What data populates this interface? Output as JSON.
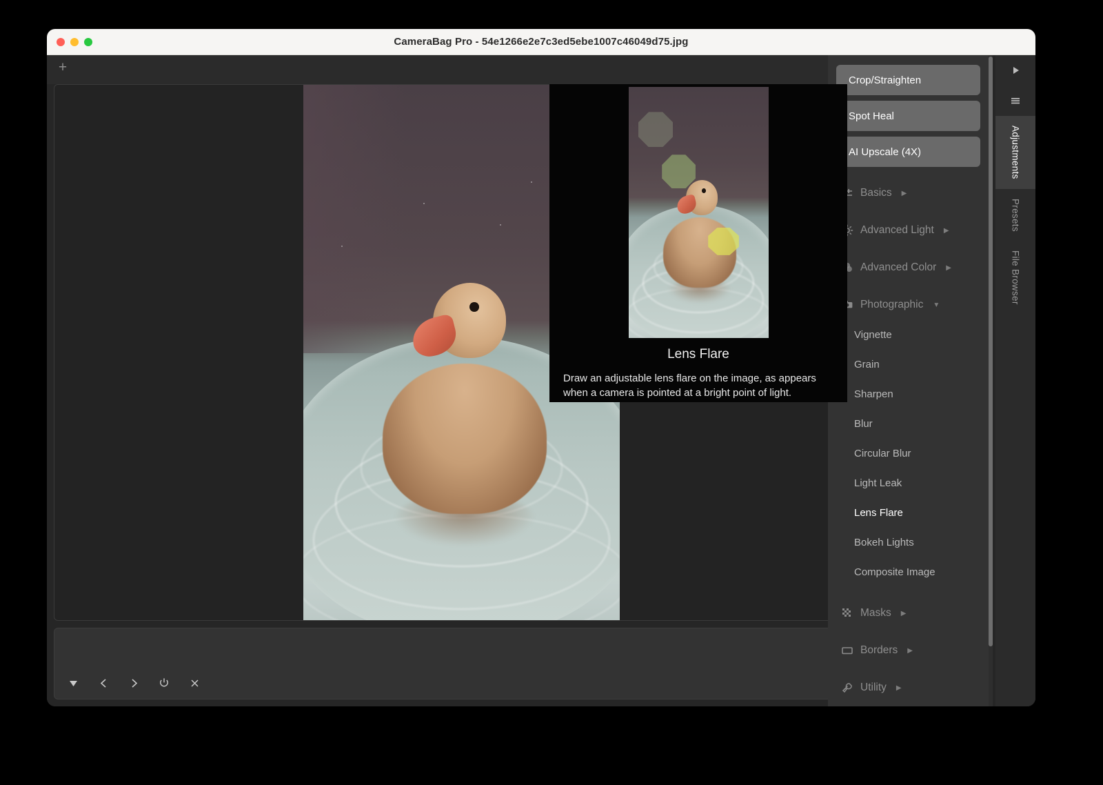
{
  "window": {
    "title": "CameraBag Pro - 54e1266e2e7c3ed5ebe1007c46049d75.jpg",
    "traffic_lights": {
      "close": "close-window",
      "minimize": "minimize-window",
      "zoom": "zoom-window"
    }
  },
  "toolbar": {
    "add_label": "+"
  },
  "info_popup": {
    "title": "Lens Flare",
    "description": "Draw an adjustable lens flare on the image, as appears when a camera is pointed at a bright point of light."
  },
  "sidebar": {
    "tool_buttons": [
      {
        "label": "Crop/Straighten",
        "name": "crop-straighten-button"
      },
      {
        "label": "Spot Heal",
        "name": "spot-heal-button"
      },
      {
        "label": "AI Upscale (4X)",
        "name": "ai-upscale-button"
      }
    ],
    "groups": [
      {
        "label": "Basics",
        "icon": "sliders-icon",
        "caret": "▶",
        "expanded": false
      },
      {
        "label": "Advanced Light",
        "icon": "sun-icon",
        "caret": "▶",
        "expanded": false
      },
      {
        "label": "Advanced Color",
        "icon": "color-circles-icon",
        "caret": "▶",
        "expanded": false
      },
      {
        "label": "Photographic",
        "icon": "camera-icon",
        "caret": "▼",
        "expanded": true
      },
      {
        "label": "Masks",
        "icon": "checker-mask-icon",
        "caret": "▶",
        "expanded": false
      },
      {
        "label": "Borders",
        "icon": "rectangle-icon",
        "caret": "▶",
        "expanded": false
      },
      {
        "label": "Utility",
        "icon": "wrench-icon",
        "caret": "▶",
        "expanded": false
      }
    ],
    "photographic_items": [
      {
        "label": "Vignette",
        "active": false
      },
      {
        "label": "Grain",
        "active": false
      },
      {
        "label": "Sharpen",
        "active": false
      },
      {
        "label": "Blur",
        "active": false
      },
      {
        "label": "Circular Blur",
        "active": false
      },
      {
        "label": "Light Leak",
        "active": false
      },
      {
        "label": "Lens Flare",
        "active": true
      },
      {
        "label": "Bokeh Lights",
        "active": false
      },
      {
        "label": "Composite Image",
        "active": false
      }
    ]
  },
  "rail": {
    "icons": [
      {
        "name": "play-triangle-icon",
        "glyph": "▶"
      },
      {
        "name": "hamburger-menu-icon",
        "glyph": "☰"
      }
    ],
    "tabs": [
      {
        "label": "Adjustments",
        "active": true
      },
      {
        "label": "Presets",
        "active": false
      },
      {
        "label": "File Browser",
        "active": false
      }
    ]
  },
  "bottom_bar": {
    "tools": [
      {
        "name": "dropdown-triangle-icon",
        "glyph": "▼"
      },
      {
        "name": "previous-icon",
        "glyph": "‹"
      },
      {
        "name": "next-icon",
        "glyph": "›"
      },
      {
        "name": "reset-power-icon",
        "glyph": "⏻"
      },
      {
        "name": "close-x-icon",
        "glyph": "✕"
      }
    ]
  },
  "colors": {
    "window_chrome": "#f6f5f3",
    "app_background": "#2b2b2b",
    "panel": "#333333",
    "tool_button": "#6a6a6a",
    "accent_text": "#ffffff",
    "muted_text": "#8f8f8f",
    "popup_background": "#050505"
  }
}
